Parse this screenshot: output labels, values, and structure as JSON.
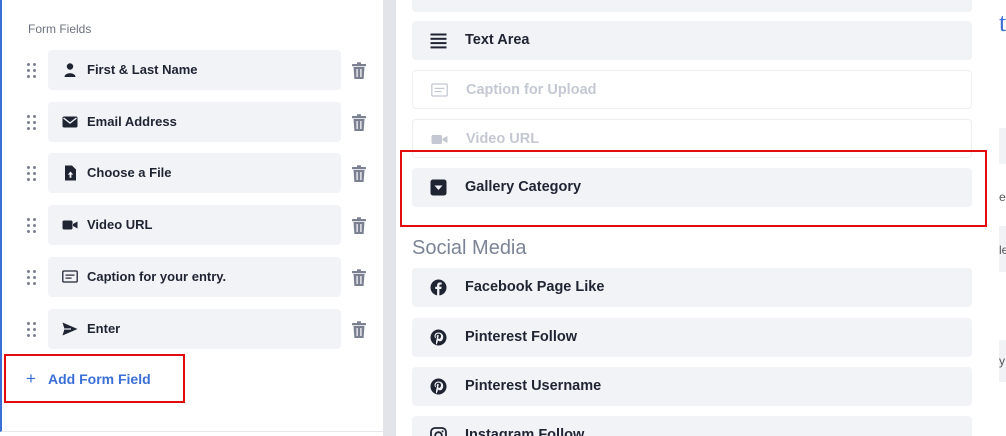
{
  "left_panel": {
    "section_label": "Form Fields",
    "fields": [
      {
        "label": "First & Last Name",
        "icon": "user-icon"
      },
      {
        "label": "Email Address",
        "icon": "envelope-icon"
      },
      {
        "label": "Choose a File",
        "icon": "file-upload-icon"
      },
      {
        "label": "Video URL",
        "icon": "video-camera-icon"
      },
      {
        "label": "Caption for your entry.",
        "icon": "caption-icon"
      },
      {
        "label": "Enter",
        "icon": "send-icon"
      }
    ],
    "add_field_label": "Add Form Field"
  },
  "mid_panel": {
    "options": [
      {
        "label": "Text Area",
        "icon": "text-lines-icon",
        "disabled": false
      },
      {
        "label": "Caption for Upload",
        "icon": "caption-icon",
        "disabled": true
      },
      {
        "label": "Video URL",
        "icon": "video-camera-icon",
        "disabled": true
      },
      {
        "label": "Gallery Category",
        "icon": "dropdown-icon",
        "disabled": false
      }
    ],
    "social_title": "Social Media",
    "social_options": [
      {
        "label": "Facebook Page Like",
        "icon": "facebook-icon"
      },
      {
        "label": "Pinterest Follow",
        "icon": "pinterest-icon"
      },
      {
        "label": "Pinterest Username",
        "icon": "pinterest-icon"
      },
      {
        "label": "Instagram Follow",
        "icon": "instagram-icon"
      }
    ]
  },
  "right_panel": {
    "title_fragment": "t",
    "snippets": [
      "es",
      "le",
      "y"
    ]
  },
  "colors": {
    "accent": "#3b6fd8",
    "highlight": "#e10d0d",
    "pill": "#f2f3f7",
    "text": "#1f2433"
  }
}
